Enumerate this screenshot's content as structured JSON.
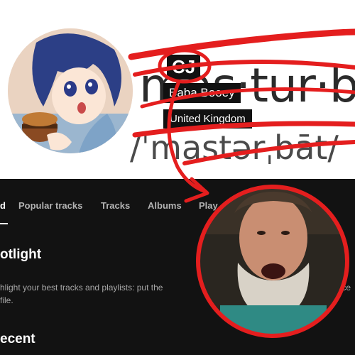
{
  "profile": {
    "initials": "CJ",
    "name": "Baba Booey",
    "country": "United Kingdom"
  },
  "banner": {
    "word": "mas·tur·b",
    "pronunciation": "/ˈmastərˌbāt/"
  },
  "nav": {
    "tabs": [
      "d",
      "Popular tracks",
      "Tracks",
      "Albums",
      "Play"
    ]
  },
  "spotlight": {
    "heading": "otlight",
    "body_line1": "hlight your best tracks and playlists: put the",
    "body_line1_end": "ence",
    "body_line2": "file."
  },
  "recent": {
    "heading": "ecent"
  },
  "colors": {
    "annotation_red": "#e41e1e",
    "background": "#121212",
    "banner_bg": "#ffffff"
  }
}
